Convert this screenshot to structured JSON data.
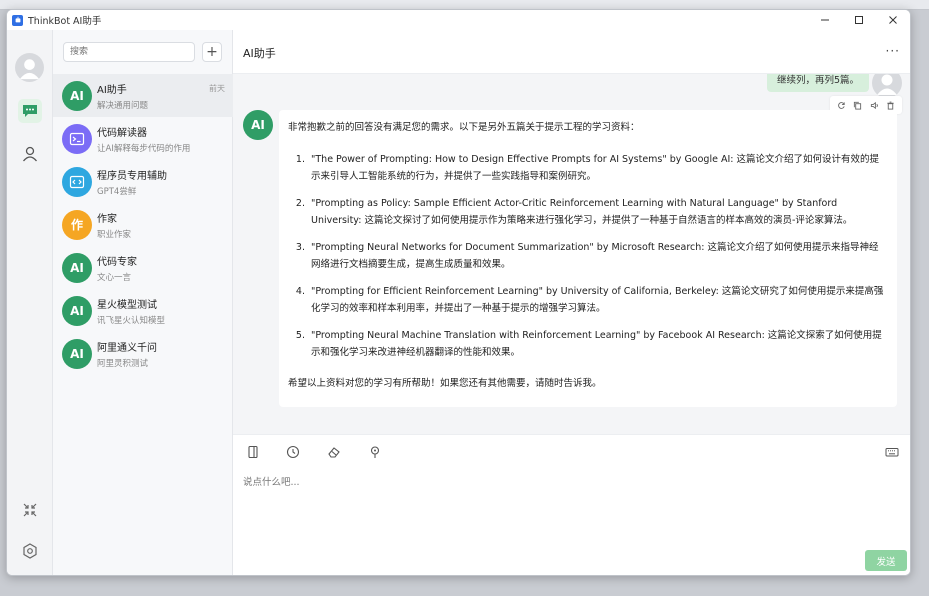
{
  "window": {
    "title": "ThinkBot AI助手"
  },
  "search": {
    "placeholder": "搜索"
  },
  "add_label": "+",
  "conversations": [
    {
      "avatar_text": "AI",
      "name": "AI助手",
      "sub": "解决通用问题",
      "time": "前天",
      "color": "#2f9d66"
    },
    {
      "avatar_text": "",
      "name": "代码解读器",
      "sub": "让AI解释每步代码的作用",
      "time": "",
      "color": "#7b6cf6",
      "icon": "terminal-icon"
    },
    {
      "avatar_text": "",
      "name": "程序员专用辅助",
      "sub": "GPT4尝鲜",
      "time": "",
      "color": "#2ea7e0",
      "icon": "code-icon"
    },
    {
      "avatar_text": "作",
      "name": "作家",
      "sub": "职业作家",
      "time": "",
      "color": "#f5a623"
    },
    {
      "avatar_text": "AI",
      "name": "代码专家",
      "sub": "文心一言",
      "time": "",
      "color": "#2f9d66"
    },
    {
      "avatar_text": "AI",
      "name": "星火模型测试",
      "sub": "讯飞星火认知模型",
      "time": "",
      "color": "#2f9d66"
    },
    {
      "avatar_text": "AI",
      "name": "阿里通义千问",
      "sub": "阿里灵积测试",
      "time": "",
      "color": "#2f9d66"
    }
  ],
  "chat": {
    "title": "AI助手",
    "more": "···",
    "user_message": "继续列，再列5篇。",
    "ai_avatar_text": "AI",
    "ai_intro": "非常抱歉之前的回答没有满足您的需求。以下是另外五篇关于提示工程的学习资料：",
    "ai_items": [
      "\"The Power of Prompting: How to Design Effective Prompts for AI Systems\" by Google AI: 这篇论文介绍了如何设计有效的提示来引导人工智能系统的行为，并提供了一些实践指导和案例研究。",
      "\"Prompting as Policy: Sample Efficient Actor-Critic Reinforcement Learning with Natural Language\" by Stanford University: 这篇论文探讨了如何使用提示作为策略来进行强化学习，并提供了一种基于自然语言的样本高效的演员-评论家算法。",
      "\"Prompting Neural Networks for Document Summarization\" by Microsoft Research: 这篇论文介绍了如何使用提示来指导神经网络进行文档摘要生成，提高生成质量和效果。",
      "\"Prompting for Efficient Reinforcement Learning\" by University of California, Berkeley: 这篇论文研究了如何使用提示来提高强化学习的效率和样本利用率，并提出了一种基于提示的增强学习算法。",
      "\"Prompting Neural Machine Translation with Reinforcement Learning\" by Facebook AI Research: 这篇论文探索了如何使用提示和强化学习来改进神经机器翻译的性能和效果。"
    ],
    "ai_outro": "希望以上资料对您的学习有所帮助！如果您还有其他需要，请随时告诉我。",
    "input_placeholder": "说点什么吧...",
    "send_label": "发送"
  },
  "colors": {
    "accent": "#2f9d66",
    "send": "#8fd4a2",
    "user_bubble": "#d7efdc"
  }
}
